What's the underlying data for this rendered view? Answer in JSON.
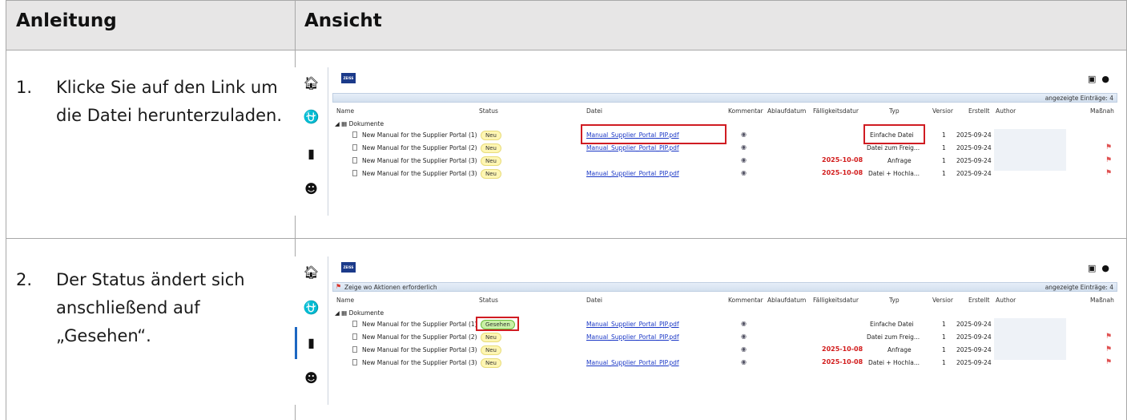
{
  "header": {
    "col1": "Anleitung",
    "col2": "Ansicht"
  },
  "steps": [
    {
      "num": "1.",
      "text": "Klicke Sie auf den Link um die Datei herunterzuladen."
    },
    {
      "num": "2.",
      "text": "Der Status ändert sich anschließend auf „Gesehen“."
    }
  ],
  "ui": {
    "logo": "ZEISS",
    "count_label": "angezeigte Einträge: 4",
    "action_filter": "Zeige wo Aktionen erforderlich",
    "columns": [
      "Name",
      "Status",
      "Datei",
      "Kommentar",
      "Ablaufdatum",
      "Fälligkeitsdatur",
      "Typ",
      "Versior",
      "Erstellt",
      "Author",
      "Maßnah"
    ],
    "folder": "Dokumente",
    "rows": [
      {
        "name": "New Manual for the Supplier Portal (1)",
        "file": "Manual_Supplier_Portal_PIP.pdf",
        "due": "",
        "type": "Einfache Datei",
        "version": "1",
        "created": "2025-09-24"
      },
      {
        "name": "New Manual for the Supplier Portal (2)",
        "file": "Manual_Supplier_Portal_PIP.pdf",
        "due": "",
        "type": "Datei zum Freig...",
        "version": "1",
        "created": "2025-09-24"
      },
      {
        "name": "New Manual for the Supplier Portal (3)",
        "file": "",
        "due": "2025-10-08",
        "type": "Anfrage",
        "version": "1",
        "created": "2025-09-24"
      },
      {
        "name": "New Manual for the Supplier Portal (3)",
        "file": "Manual_Supplier_Portal_PIP.pdf",
        "due": "2025-10-08",
        "type": "Datei + Hochla...",
        "version": "1",
        "created": "2025-09-24"
      }
    ],
    "status_new": "Neu",
    "status_seen": "Gesehen"
  }
}
